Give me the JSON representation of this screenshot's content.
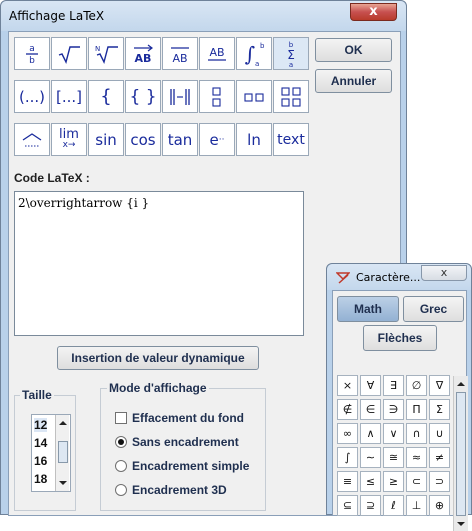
{
  "main_window": {
    "title": "Affichage LaTeX",
    "close_glyph": "x",
    "toolbar_row1": [
      "fraction-icon",
      "sqrt-icon",
      "nthroot-icon",
      "vector-icon",
      "segment-icon",
      "underline-icon",
      "integral-icon",
      "sum-icon"
    ],
    "toolbar_row2": [
      "parentheses-icon",
      "brackets-icon",
      "braces-icon",
      "braces-wide-icon",
      "determinant-icon",
      "matrix-2x1-icon",
      "matrix-1x2-icon",
      "matrix-2x2-icon"
    ],
    "toolbar_row3": {
      "hat": "^",
      "lim": "lim",
      "lim_sub": "x→",
      "sin": "sin",
      "cos": "cos",
      "tan": "tan",
      "exp": "e",
      "ln": "ln",
      "text": "text"
    },
    "ok_label": "OK",
    "cancel_label": "Annuler",
    "code_label": "Code LaTeX :",
    "code_value": "2\\overrightarrow {i }",
    "insert_button": "Insertion de valeur dynamique",
    "size_legend": "Taille",
    "size_options": [
      "12",
      "14",
      "16",
      "18"
    ],
    "size_selected": "12",
    "mode_legend": "Mode d'affichage",
    "option_bg": "Effacement du fond",
    "option_none": "Sans encadrement",
    "option_simple": "Encadrement simple",
    "option_3d": "Encadrement 3D"
  },
  "char_window": {
    "title": "Caractère...",
    "close_glyph": "x",
    "tab_math": "Math",
    "tab_greek": "Grec",
    "tab_arrows": "Flèches",
    "rows": [
      [
        "×",
        "∀",
        "∃",
        "∅",
        "∇"
      ],
      [
        "∉",
        "∈",
        "∋",
        "Π",
        "Σ"
      ],
      [
        "∞",
        "∧",
        "∨",
        "∩",
        "∪"
      ],
      [
        "∫",
        "∼",
        "≅",
        "≈",
        "≠"
      ],
      [
        "≡",
        "≤",
        "≥",
        "⊂",
        "⊃"
      ],
      [
        "⊆",
        "⊇",
        "ℓ",
        "⊥",
        "⊕"
      ]
    ]
  }
}
